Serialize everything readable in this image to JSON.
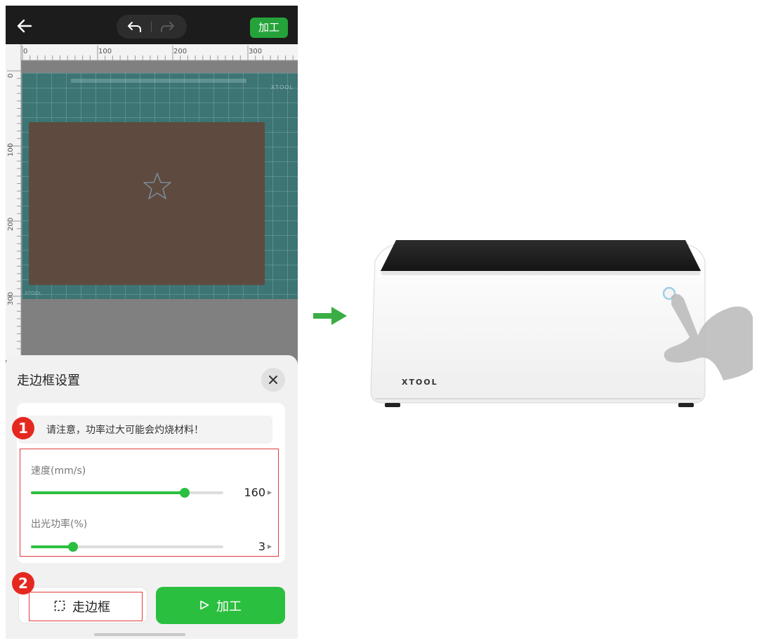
{
  "app": {
    "process_button": "加工"
  },
  "ruler": {
    "top_ticks": [
      "0",
      "100",
      "200",
      "300"
    ],
    "left_ticks": [
      "0",
      "100",
      "200",
      "300"
    ]
  },
  "canvas": {
    "bed_brand": "XTOOL",
    "bed_brand_small": "XTOOL"
  },
  "sheet": {
    "title": "走边框设置",
    "warning": "请注意，功率过大可能会灼烧材料！",
    "speed": {
      "label": "速度(mm/s)",
      "value": "160",
      "fraction": 0.8
    },
    "power": {
      "label": "出光功率(%)",
      "value": "3",
      "fraction": 0.22
    },
    "frame_button": "走边框",
    "process_button": "加工"
  },
  "badges": [
    "1",
    "2"
  ],
  "machine": {
    "brand": "XTOOL"
  },
  "colors": {
    "accent_green": "#2bbf3f",
    "highlight_red": "#e23a3a",
    "badge_red": "#e5281f",
    "topbar": "#1c1c1c"
  },
  "icons": [
    "back-arrow-icon",
    "undo-icon",
    "redo-icon",
    "close-icon",
    "frame-icon",
    "play-icon",
    "right-arrow-icon",
    "hand-pointer-icon"
  ]
}
